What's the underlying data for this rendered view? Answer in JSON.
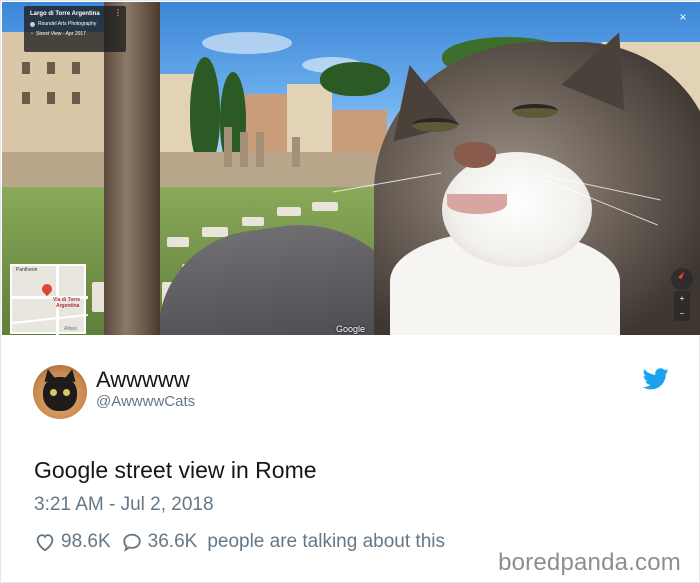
{
  "streetview": {
    "location_title": "Largo di Torre Argentina",
    "photographer": "Roundel Arts Photography",
    "date": "Street View - Apr 2017",
    "close_symbol": "×",
    "kebab_symbol": "⋮",
    "minimap_top_label": "Pantheon",
    "minimap_pin_label_line1": "Via di Torre",
    "minimap_pin_label_line2": "Argentina",
    "minimap_bottom_label": "Altare",
    "google_label": "Google",
    "zoom_in": "+",
    "zoom_out": "−"
  },
  "tweet": {
    "display_name": "Awwwww",
    "handle": "@AwwwwCats",
    "text": "Google street view in Rome",
    "timestamp": "3:21 AM - Jul 2, 2018",
    "likes": "98.6K",
    "replies": "36.6K",
    "replies_suffix": "people are talking about this"
  },
  "watermark": "boredpanda.com",
  "colors": {
    "twitter_blue": "#1da1f2",
    "secondary_text": "#657786",
    "primary_text": "#14171a"
  },
  "icons": [
    "heart-icon",
    "speech-bubble-icon",
    "twitter-bird-icon",
    "close-icon",
    "more-icon",
    "compass-icon",
    "map-pin-icon"
  ]
}
